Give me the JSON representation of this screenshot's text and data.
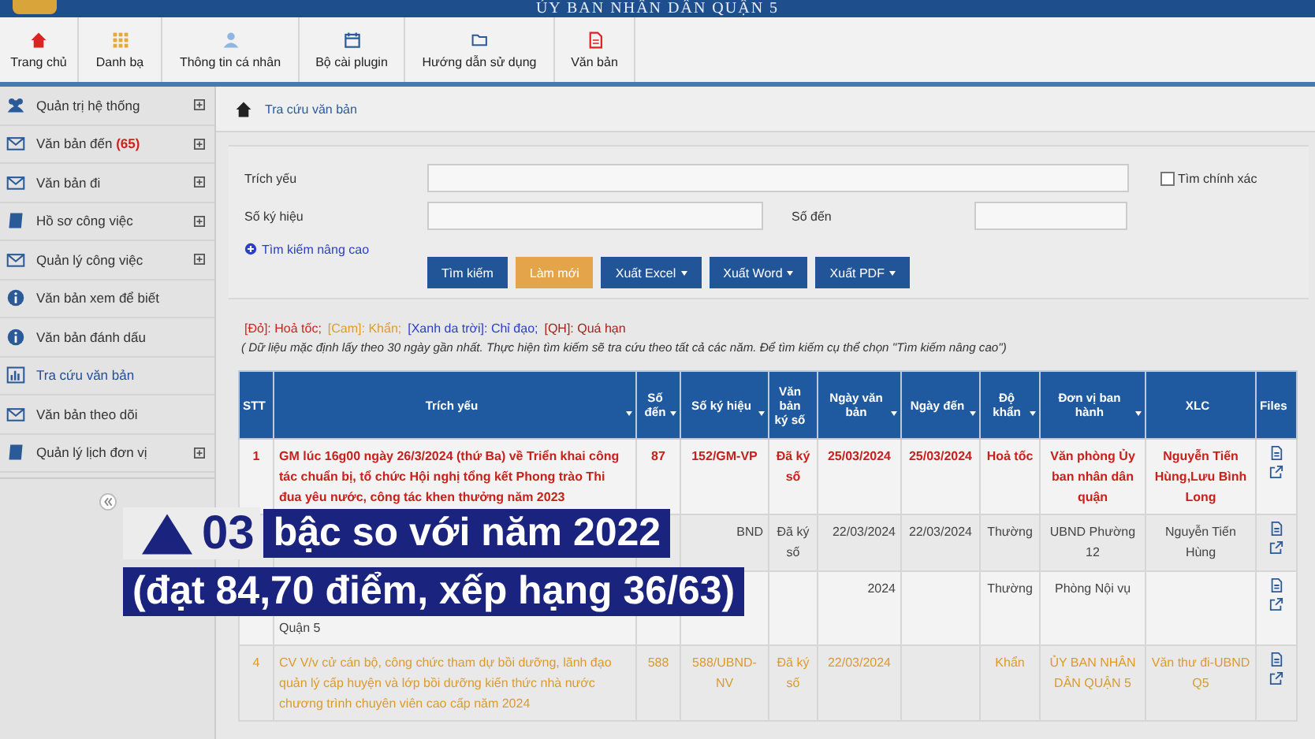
{
  "header": {
    "title": "ỦY BAN NHÂN DÂN QUẬN 5"
  },
  "nav": [
    {
      "label": "Trang chủ"
    },
    {
      "label": "Danh bạ"
    },
    {
      "label": "Thông tin cá nhân"
    },
    {
      "label": "Bộ cài plugin"
    },
    {
      "label": "Hướng dẫn sử dụng"
    },
    {
      "label": "Văn bản"
    }
  ],
  "sidebar": {
    "items": [
      {
        "label": "Quản trị hệ thống",
        "expandable": true,
        "selected": false
      },
      {
        "label": "Văn bản đến",
        "badge": "(65)",
        "expandable": true,
        "selected": false
      },
      {
        "label": "Văn bản đi",
        "expandable": true,
        "selected": false
      },
      {
        "label": "Hồ sơ công việc",
        "expandable": true,
        "selected": false
      },
      {
        "label": "Quản lý công việc",
        "expandable": true,
        "selected": false
      },
      {
        "label": "Văn bản xem để biết",
        "expandable": false,
        "selected": false
      },
      {
        "label": "Văn bản đánh dấu",
        "expandable": false,
        "selected": false
      },
      {
        "label": "Tra cứu văn bản",
        "expandable": false,
        "selected": true
      },
      {
        "label": "Văn bản theo dõi",
        "expandable": false,
        "selected": false
      },
      {
        "label": "Quản lý lịch đơn vị",
        "expandable": true,
        "selected": false
      }
    ]
  },
  "breadcrumb": "Tra cứu văn bản",
  "form": {
    "trich_yeu_label": "Trích yếu",
    "exact_label": "Tìm chính xác",
    "exact_checked": false,
    "so_ky_hieu_label": "Số ký hiệu",
    "so_den_label": "Số đến",
    "advanced_link": "Tìm kiếm nâng cao",
    "buttons": [
      {
        "label": "Tìm kiếm",
        "kind": "primary",
        "dropdown": false
      },
      {
        "label": "Làm mới",
        "kind": "warning",
        "dropdown": false
      },
      {
        "label": "Xuất Excel",
        "kind": "primary",
        "dropdown": true
      },
      {
        "label": "Xuất Word",
        "kind": "primary",
        "dropdown": true
      },
      {
        "label": "Xuất PDF",
        "kind": "primary",
        "dropdown": true
      }
    ]
  },
  "legend": [
    {
      "text": "[Đỏ]: Hoả tốc;",
      "color": "#d0211c"
    },
    {
      "text": "[Cam]: Khẩn;",
      "color": "#e39b1f"
    },
    {
      "text": "[Xanh da trời]: Chỉ đạo;",
      "color": "#2a3fc4"
    },
    {
      "text": "[QH]: Quá hạn",
      "color": "#a0241c"
    }
  ],
  "note": "( Dữ liệu mặc định lấy theo 30 ngày gần nhất. Thực hiện tìm kiếm sẽ tra cứu theo tất cả các năm. Để tìm kiếm cụ thể chọn \"Tìm kiếm nâng cao\")",
  "table": {
    "columns": [
      {
        "label": "STT",
        "sortable": false
      },
      {
        "label": "Trích yếu",
        "sortable": true
      },
      {
        "label": "Số đến",
        "sortable": true
      },
      {
        "label": "Số ký hiệu",
        "sortable": true
      },
      {
        "label": "Văn bản ký số",
        "sortable": false
      },
      {
        "label": "Ngày văn bản",
        "sortable": true
      },
      {
        "label": "Ngày đến",
        "sortable": true
      },
      {
        "label": "Độ khẩn",
        "sortable": true
      },
      {
        "label": "Đơn vị ban hành",
        "sortable": true
      },
      {
        "label": "XLC",
        "sortable": false
      },
      {
        "label": "Files",
        "sortable": false
      }
    ],
    "rows": [
      {
        "kind": "hoa_toc",
        "files": true,
        "stt": "1",
        "trich_yeu": "GM lúc 16g00 ngày 26/3/2024 (thứ Ba) về Triển khai công tác chuẩn bị, tổ chức Hội nghị tổng kết Phong trào Thi đua yêu nước, công tác khen thưởng năm 2023",
        "so_den": "87",
        "so_ky_hieu": "152/GM-VP",
        "ky_so": "Đã ký số",
        "ngay_vb": "25/03/2024",
        "ngay_den": "25/03/2024",
        "do_khan": "Hoả tốc",
        "don_vi": "Văn phòng Ủy ban nhân dân quận",
        "xlc": "Nguyễn Tiến Hùng,Lưu Bình Long"
      },
      {
        "kind": "thuong",
        "files": true,
        "so_ky_hieu": "BND",
        "ky_so": "Đã ký số",
        "ngay_vb": "22/03/2024",
        "ngay_den": "22/03/2024",
        "do_khan": "Thường",
        "don_vi": "UBND Phường 12",
        "xlc": "Nguyễn Tiến Hùng"
      },
      {
        "kind": "thuong",
        "files": true,
        "trich_yeu": "Quận 5",
        "ngay_vb": "2024",
        "do_khan": "Thường",
        "don_vi": "Phòng Nội vụ"
      },
      {
        "kind": "khan",
        "files": true,
        "stt": "4",
        "trich_yeu": "CV V/v cử cán bộ, công chức tham dự bồi dưỡng, lãnh đạo quản lý cấp huyện và lớp bồi dưỡng kiến thức nhà nước chương trình chuyên viên cao cấp năm 2024",
        "so_den": "588",
        "so_ky_hieu": "588/UBND-NV",
        "ky_so": "Đã ký số",
        "ngay_vb": "22/03/2024",
        "do_khan": "Khẩn",
        "don_vi": "ỦY BAN NHÂN DÂN QUẬN 5",
        "xlc": "Văn thư đi-UBND Q5"
      }
    ]
  },
  "caption": {
    "rank_change": "03",
    "line_1": "bậc so với năm 2022",
    "line_2": "(đạt 84,70 điểm, xếp hạng 36/63)"
  }
}
